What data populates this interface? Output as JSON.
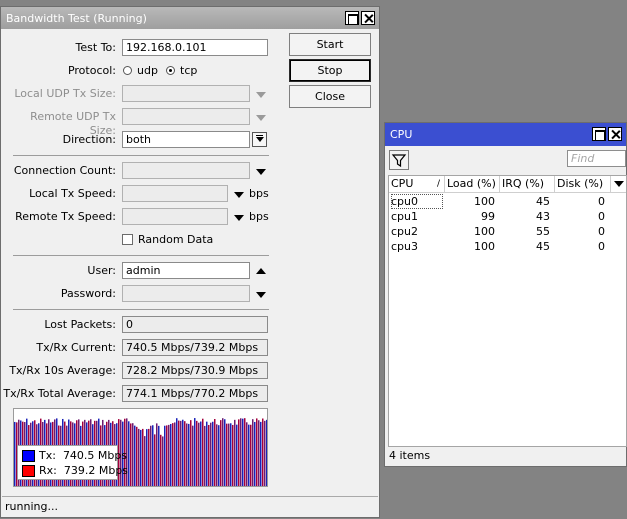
{
  "bandwidth_window": {
    "title": "Bandwidth Test (Running)",
    "fields": {
      "test_to": {
        "label": "Test To:",
        "value": "192.168.0.101"
      },
      "protocol": {
        "label": "Protocol:",
        "options": [
          "udp",
          "tcp"
        ],
        "selected": "tcp"
      },
      "local_udp_tx_size": {
        "label": "Local UDP Tx Size:",
        "value": ""
      },
      "remote_udp_tx_size": {
        "label": "Remote UDP Tx Size:",
        "value": ""
      },
      "direction": {
        "label": "Direction:",
        "value": "both"
      },
      "connection_count": {
        "label": "Connection Count:",
        "value": ""
      },
      "local_tx_speed": {
        "label": "Local Tx Speed:",
        "value": "",
        "unit": "bps"
      },
      "remote_tx_speed": {
        "label": "Remote Tx Speed:",
        "value": "",
        "unit": "bps"
      },
      "random_data": {
        "label": "Random Data",
        "checked": false
      },
      "user": {
        "label": "User:",
        "value": "admin"
      },
      "password": {
        "label": "Password:",
        "value": ""
      },
      "lost_packets": {
        "label": "Lost Packets:",
        "value": "0"
      },
      "txrx_current": {
        "label": "Tx/Rx Current:",
        "value": "740.5 Mbps/739.2 Mbps"
      },
      "txrx_10s_average": {
        "label": "Tx/Rx 10s Average:",
        "value": "728.2 Mbps/730.9 Mbps"
      },
      "txrx_total_average": {
        "label": "Tx/Rx Total Average:",
        "value": "774.1 Mbps/770.2 Mbps"
      }
    },
    "buttons": {
      "start": "Start",
      "stop": "Stop",
      "close": "Close"
    },
    "legend": {
      "tx": {
        "label": "Tx:",
        "value": "740.5 Mbps",
        "color": "#0000ff"
      },
      "rx": {
        "label": "Rx:",
        "value": "739.2 Mbps",
        "color": "#ff0000"
      }
    },
    "graph_colors": {
      "tx": "#1a22b8",
      "rx": "#a3003d",
      "mix": "#6d1a70"
    },
    "status": "running..."
  },
  "cpu_window": {
    "title": "CPU",
    "find_placeholder": "Find",
    "columns": [
      "CPU",
      "Load (%)",
      "IRQ (%)",
      "Disk (%)"
    ],
    "rows": [
      {
        "cpu": "cpu0",
        "load": "100",
        "irq": "45",
        "disk": "0"
      },
      {
        "cpu": "cpu1",
        "load": "99",
        "irq": "43",
        "disk": "0"
      },
      {
        "cpu": "cpu2",
        "load": "100",
        "irq": "55",
        "disk": "0"
      },
      {
        "cpu": "cpu3",
        "load": "100",
        "irq": "45",
        "disk": "0"
      }
    ],
    "status": "4 items",
    "title_color": "#3b4fd1"
  }
}
